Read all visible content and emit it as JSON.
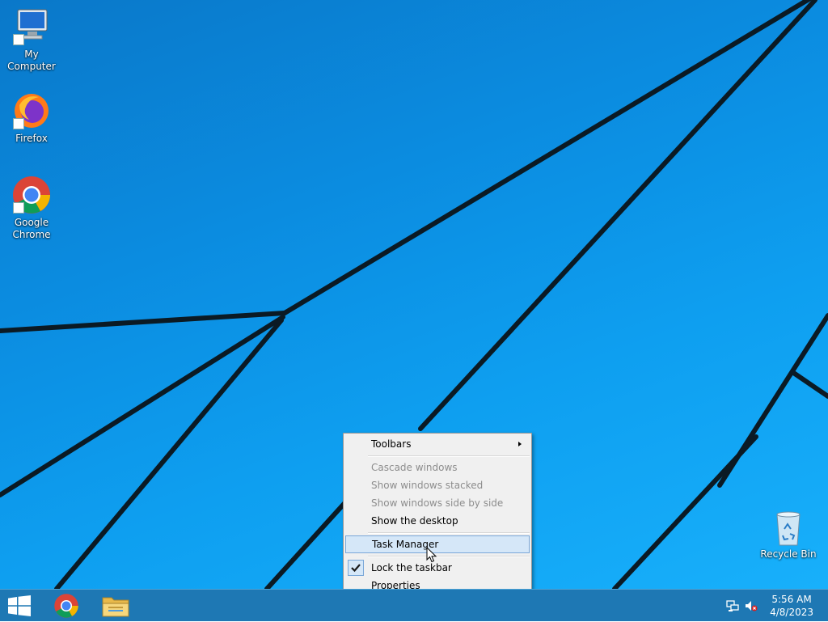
{
  "desktop": {
    "icons": [
      {
        "label": "My Computer",
        "icon": "computer-icon"
      },
      {
        "label": "Firefox",
        "icon": "firefox-icon"
      },
      {
        "label": "Google Chrome",
        "icon": "chrome-icon"
      },
      {
        "label": "Recycle Bin",
        "icon": "recycle-bin-icon"
      }
    ]
  },
  "context_menu": {
    "items": [
      {
        "label": "Toolbars",
        "state": "enabled",
        "has_submenu": true
      },
      {
        "label": "Cascade windows",
        "state": "disabled"
      },
      {
        "label": "Show windows stacked",
        "state": "disabled"
      },
      {
        "label": "Show windows side by side",
        "state": "disabled"
      },
      {
        "label": "Show the desktop",
        "state": "enabled"
      },
      {
        "label": "Task Manager",
        "state": "hovered"
      },
      {
        "label": "Lock the taskbar",
        "state": "checked"
      },
      {
        "label": "Properties",
        "state": "enabled"
      }
    ]
  },
  "taskbar": {
    "start_icon": "windows-logo-icon",
    "pinned": [
      {
        "name": "Google Chrome",
        "icon": "chrome-icon"
      },
      {
        "name": "File Explorer",
        "icon": "folder-icon"
      }
    ],
    "tray_icons": [
      "network-icon",
      "volume-muted-icon"
    ],
    "clock": {
      "time": "5:56 AM",
      "date": "4/8/2023"
    }
  },
  "colors": {
    "desktop_accent": "#0e9ff0",
    "taskbar": "#1e78b4",
    "menu_background": "#f0f0f0",
    "menu_hover": "#d5e7f8"
  }
}
